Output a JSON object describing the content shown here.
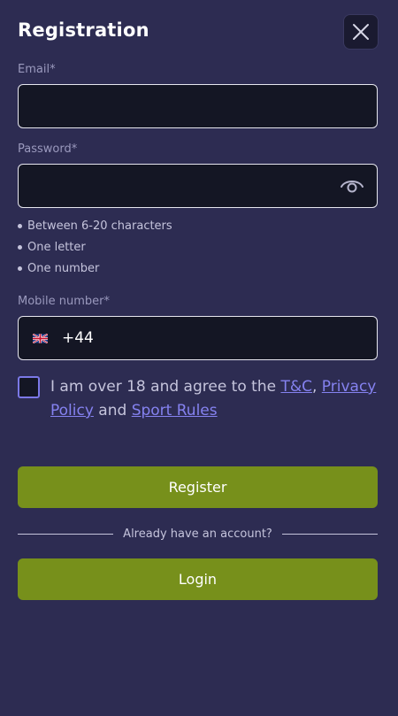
{
  "header": {
    "title": "Registration",
    "close_icon": "close-icon"
  },
  "email": {
    "label": "Email*",
    "value": ""
  },
  "password": {
    "label": "Password*",
    "value": "",
    "toggle_icon": "eye-icon",
    "rules": [
      "Between 6-20 characters",
      "One letter",
      "One number"
    ]
  },
  "mobile": {
    "label": "Mobile number*",
    "country_flag": "uk-flag-icon",
    "dial_code": "+44"
  },
  "consent": {
    "checked": false,
    "text_prefix": "I am over 18 and agree to the ",
    "tc_link": "T&C",
    "separator": ", ",
    "privacy_link": "Privacy Policy",
    "and_text": " and ",
    "sport_rules_link": "Sport Rules"
  },
  "actions": {
    "register_label": "Register",
    "divider_text": "Already have an account?",
    "login_label": "Login"
  },
  "colors": {
    "background": "#2d2c52",
    "input_bg": "#141624",
    "button_green": "#77901b",
    "link": "#8582f0"
  }
}
